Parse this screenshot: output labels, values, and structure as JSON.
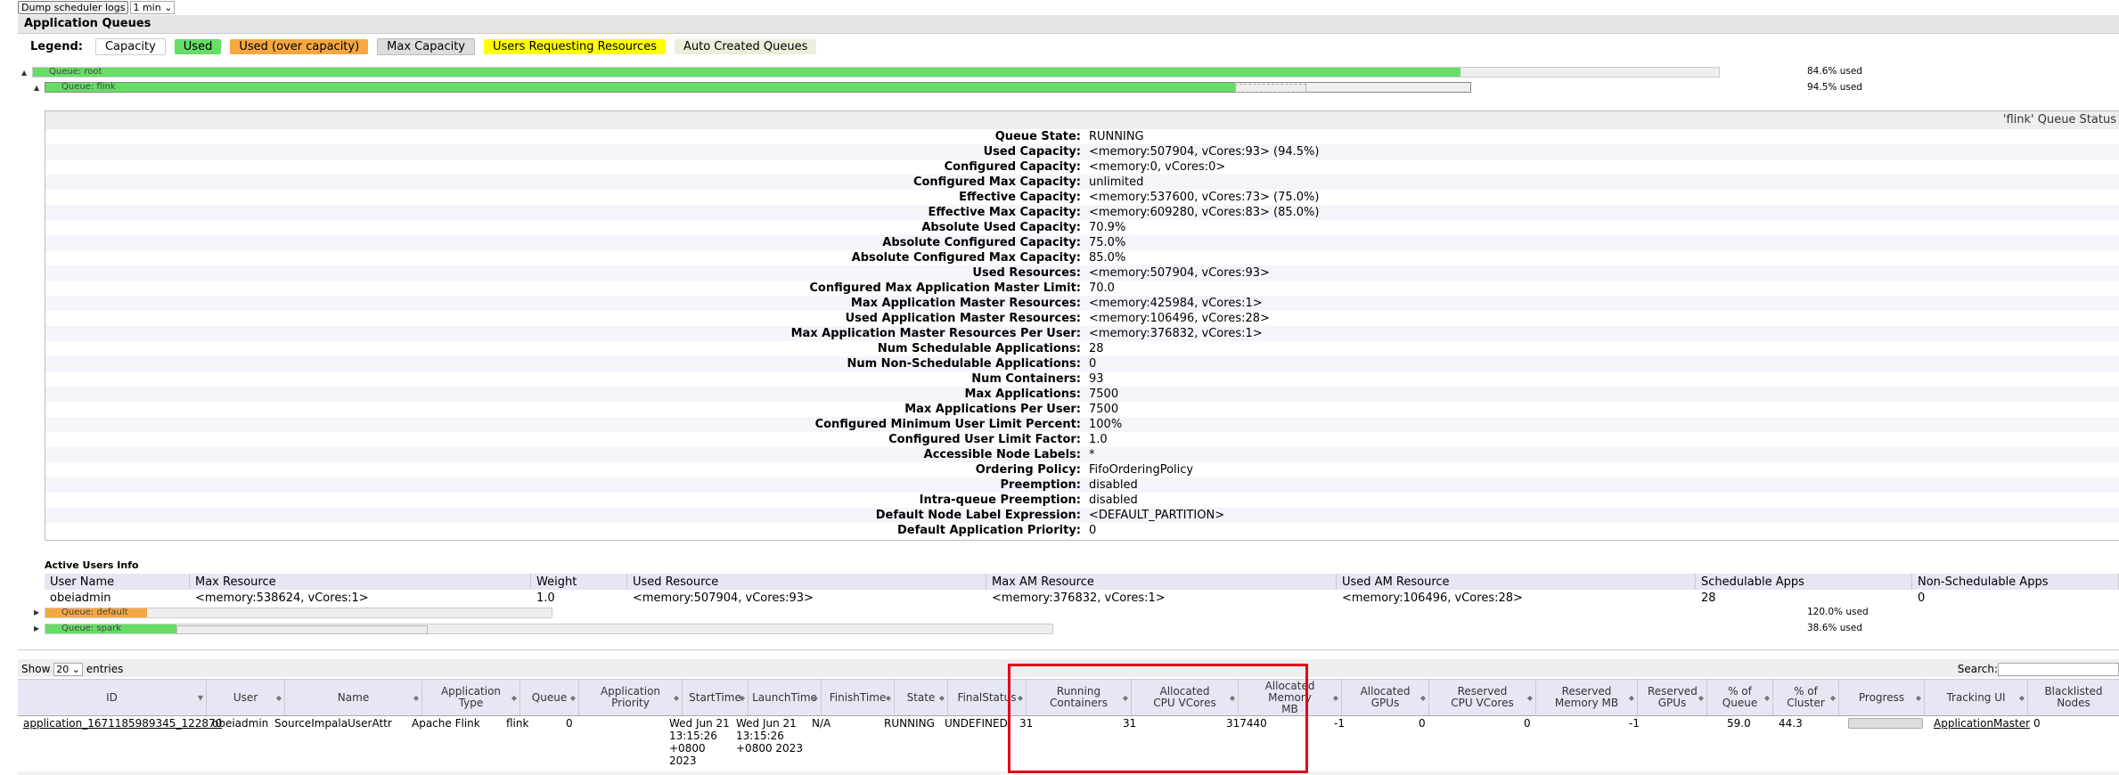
{
  "topbar": {
    "dump_button": "Dump scheduler logs",
    "interval": "1 min"
  },
  "app_queues": {
    "title": "Application Queues"
  },
  "legend": {
    "label": "Legend:",
    "items": [
      {
        "label": "Capacity",
        "color": "#ffffff"
      },
      {
        "label": "Used",
        "color": "#66dd66"
      },
      {
        "label": "Used (over capacity)",
        "color": "#f5a742"
      },
      {
        "label": "Max Capacity",
        "color": "#dddddd"
      },
      {
        "label": "Users Requesting Resources",
        "color": "#ffff00"
      },
      {
        "label": "Auto Created Queues",
        "color": "#eeeedd"
      }
    ]
  },
  "queues": {
    "root": {
      "label": "Queue: root",
      "used": "84.6% used",
      "fill": 0.846
    },
    "flink": {
      "label": "Queue: flink",
      "used": "94.5% used",
      "fill": 0.945
    },
    "default": {
      "label": "Queue: default",
      "used": "120.0% used"
    },
    "spark": {
      "label": "Queue: spark",
      "used": "38.6% used"
    }
  },
  "status": {
    "title": "'flink' Queue Status",
    "rows": [
      {
        "k": "Queue State:",
        "v": "RUNNING"
      },
      {
        "k": "Used Capacity:",
        "v": "<memory:507904, vCores:93> (94.5%)"
      },
      {
        "k": "Configured Capacity:",
        "v": "<memory:0, vCores:0>"
      },
      {
        "k": "Configured Max Capacity:",
        "v": "unlimited"
      },
      {
        "k": "Effective Capacity:",
        "v": "<memory:537600, vCores:73> (75.0%)"
      },
      {
        "k": "Effective Max Capacity:",
        "v": "<memory:609280, vCores:83> (85.0%)"
      },
      {
        "k": "Absolute Used Capacity:",
        "v": "70.9%"
      },
      {
        "k": "Absolute Configured Capacity:",
        "v": "75.0%"
      },
      {
        "k": "Absolute Configured Max Capacity:",
        "v": "85.0%"
      },
      {
        "k": "Used Resources:",
        "v": "<memory:507904, vCores:93>"
      },
      {
        "k": "Configured Max Application Master Limit:",
        "v": "70.0"
      },
      {
        "k": "Max Application Master Resources:",
        "v": "<memory:425984, vCores:1>"
      },
      {
        "k": "Used Application Master Resources:",
        "v": "<memory:106496, vCores:28>"
      },
      {
        "k": "Max Application Master Resources Per User:",
        "v": "<memory:376832, vCores:1>"
      },
      {
        "k": "Num Schedulable Applications:",
        "v": "28"
      },
      {
        "k": "Num Non-Schedulable Applications:",
        "v": "0"
      },
      {
        "k": "Num Containers:",
        "v": "93"
      },
      {
        "k": "Max Applications:",
        "v": "7500"
      },
      {
        "k": "Max Applications Per User:",
        "v": "7500"
      },
      {
        "k": "Configured Minimum User Limit Percent:",
        "v": "100%"
      },
      {
        "k": "Configured User Limit Factor:",
        "v": "1.0"
      },
      {
        "k": "Accessible Node Labels:",
        "v": "*"
      },
      {
        "k": "Ordering Policy:",
        "v": "FifoOrderingPolicy"
      },
      {
        "k": "Preemption:",
        "v": "disabled"
      },
      {
        "k": "Intra-queue Preemption:",
        "v": "disabled"
      },
      {
        "k": "Default Node Label Expression:",
        "v": "<DEFAULT_PARTITION>"
      },
      {
        "k": "Default Application Priority:",
        "v": "0"
      }
    ]
  },
  "active_users": {
    "title": "Active Users Info",
    "headers": [
      "User Name",
      "Max Resource",
      "Weight",
      "Used Resource",
      "Max AM Resource",
      "Used AM Resource",
      "Schedulable Apps",
      "Non-Schedulable Apps"
    ],
    "row": [
      "obeiadmin",
      "<memory:538624, vCores:1>",
      "1.0",
      "<memory:507904, vCores:93>",
      "<memory:376832, vCores:1>",
      "<memory:106496, vCores:28>",
      "28",
      "0"
    ]
  },
  "apps": {
    "show": "Show",
    "entries_count": "20",
    "entries": "entries",
    "search": "Search:",
    "headers": [
      "ID",
      "User",
      "Name",
      "Application Type",
      "Queue",
      "Application Priority",
      "StartTime",
      "LaunchTime",
      "FinishTime",
      "State",
      "FinalStatus",
      "Running Containers",
      "Allocated CPU VCores",
      "Allocated Memory MB",
      "Allocated GPUs",
      "Reserved CPU VCores",
      "Reserved Memory MB",
      "Reserved GPUs",
      "% of Queue",
      "% of Cluster",
      "Progress",
      "Tracking UI",
      "Blacklisted Nodes"
    ],
    "row": {
      "id": "application_1671185989345_122870",
      "user": "obeiadmin",
      "name": "SourceImpalaUserAttr",
      "type": "Apache Flink",
      "queue": "flink",
      "priority": "0",
      "start": "Wed Jun 21 13:15:26 +0800 2023",
      "launch": "Wed Jun 21 13:15:26 +0800 2023",
      "finish": "N/A",
      "state": "RUNNING",
      "final": "UNDEFINED",
      "containers": "31",
      "vcores": "31",
      "memory": "317440",
      "gpus": "-1",
      "rvcores": "0",
      "rmem": "0",
      "rgpus": "-1",
      "pq": "59.0",
      "pc": "44.3",
      "tracking": "ApplicationMaster",
      "blacklisted": "0"
    }
  }
}
